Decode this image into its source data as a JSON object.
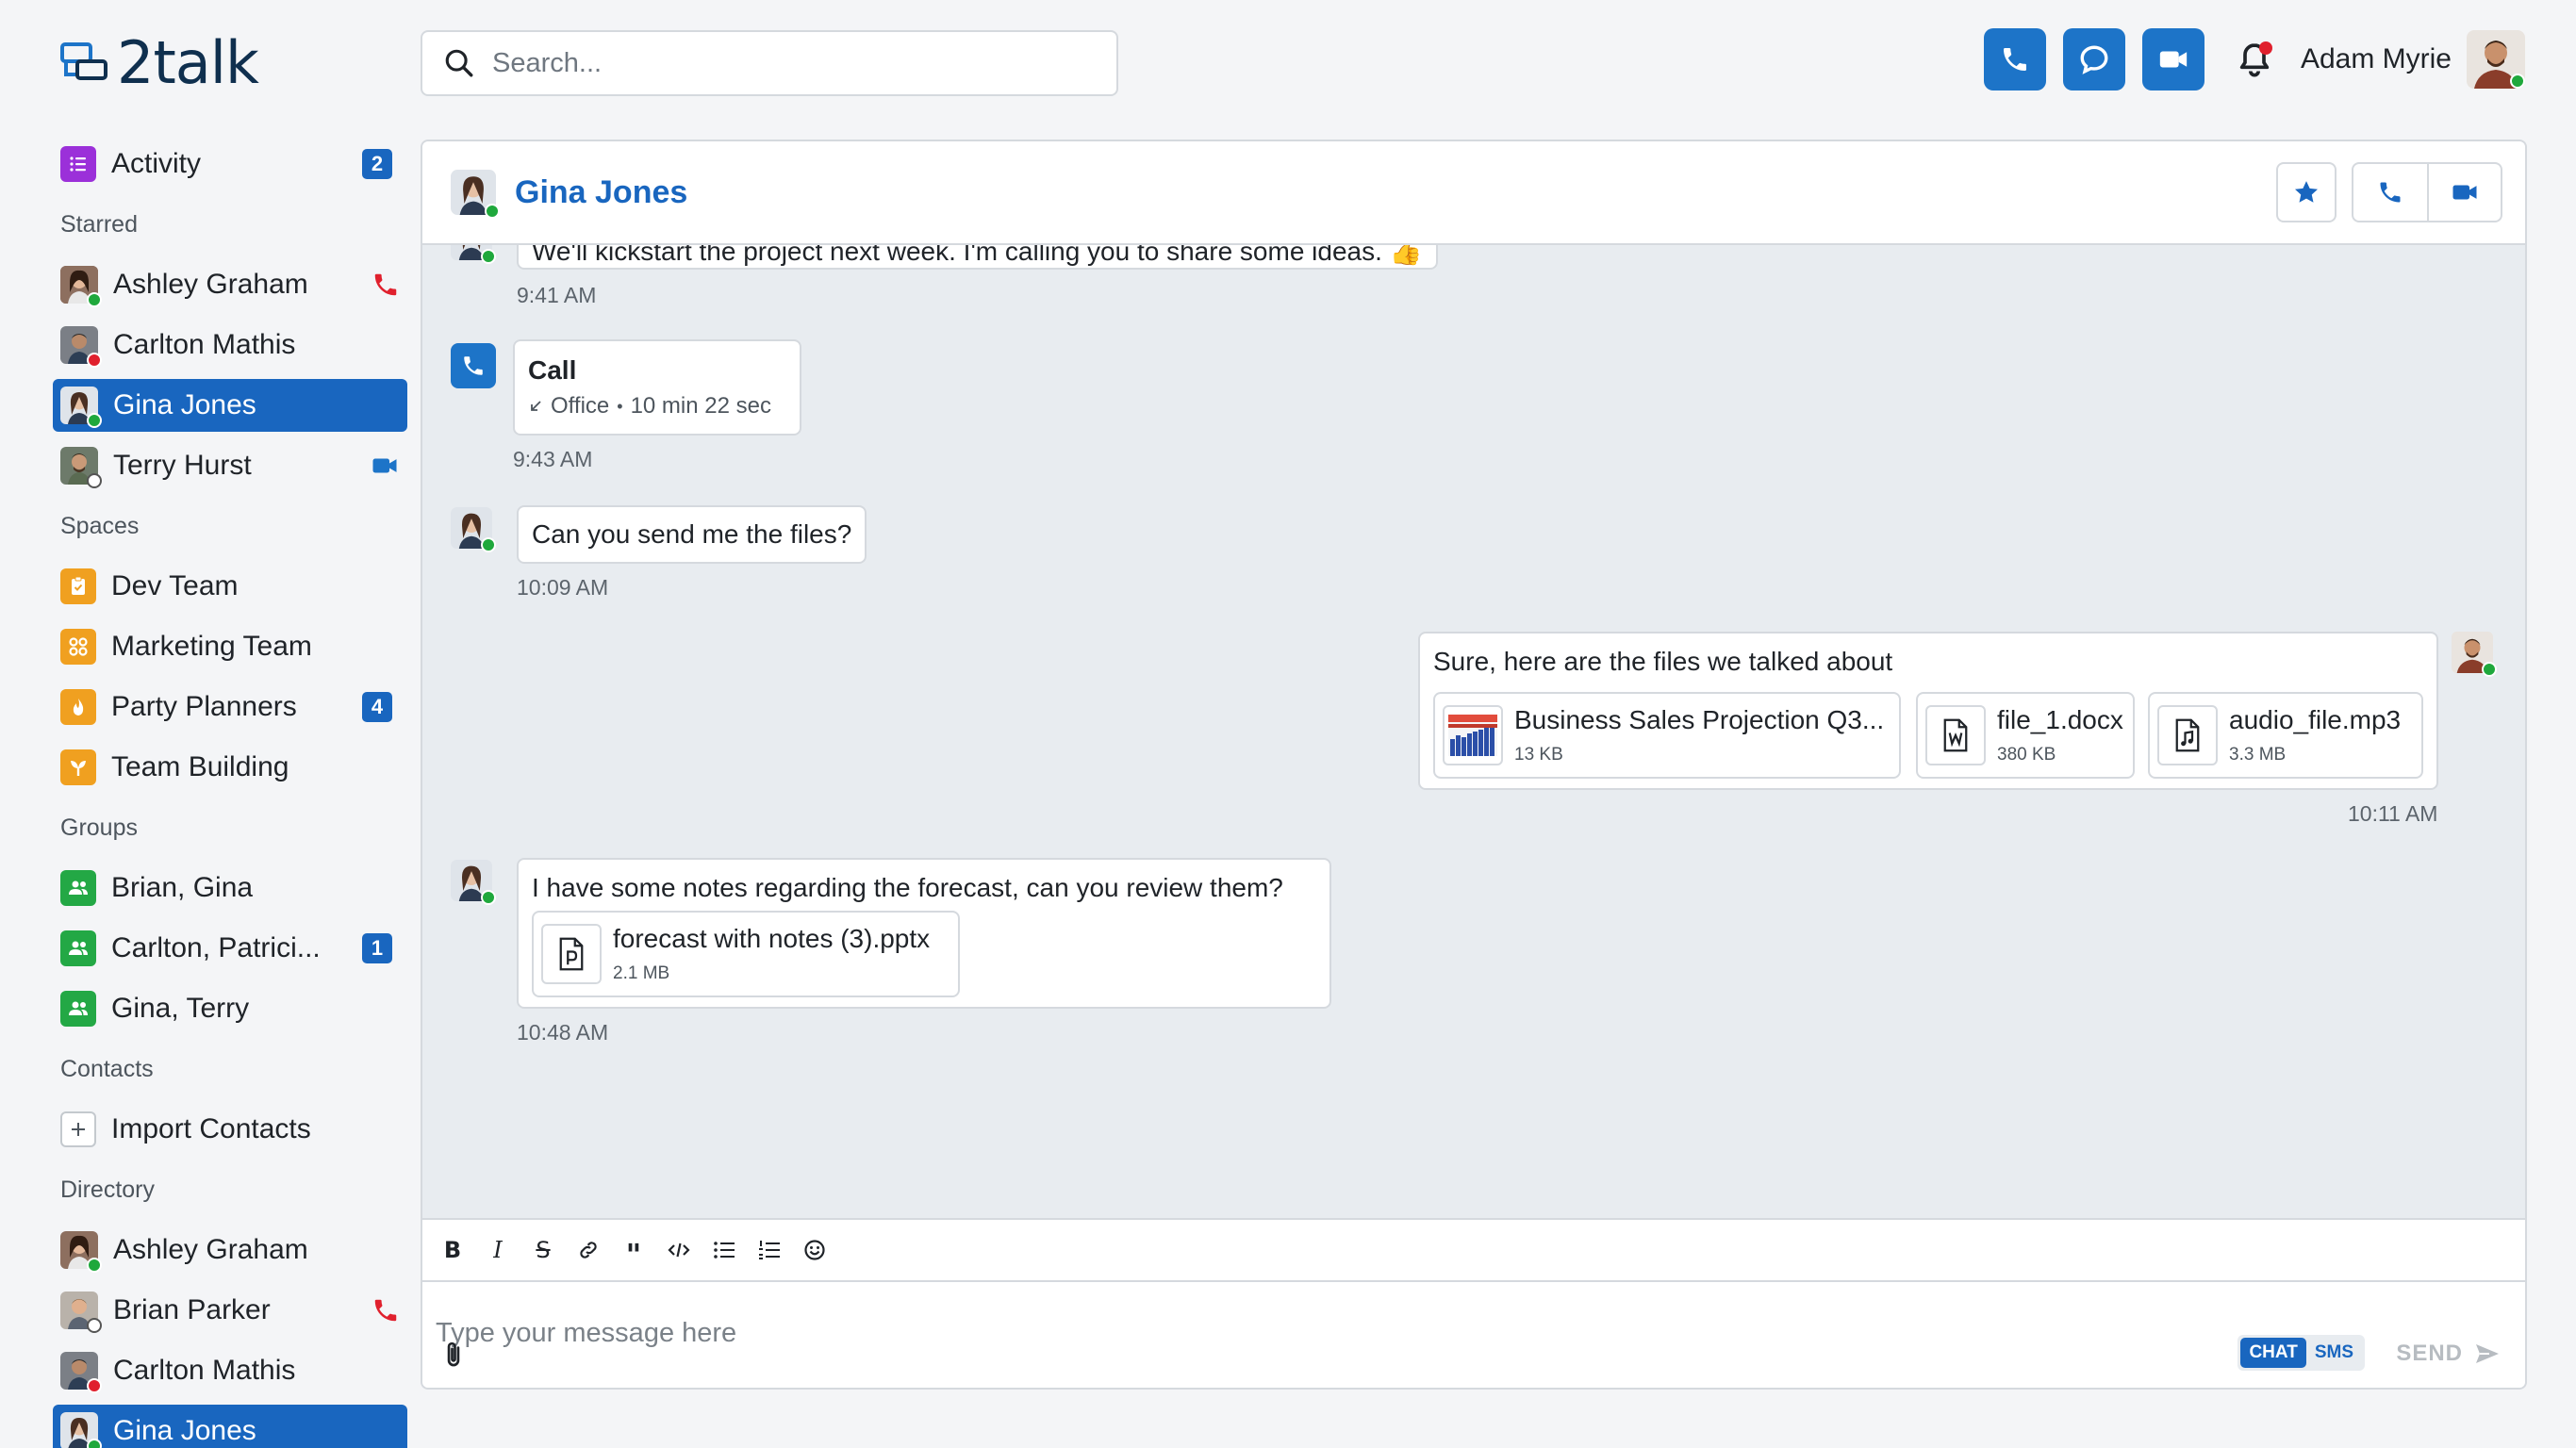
{
  "app": {
    "logo_text": "2talk"
  },
  "search": {
    "placeholder": "Search..."
  },
  "user": {
    "name": "Adam Myrie"
  },
  "sidebar": {
    "activity": {
      "label": "Activity",
      "badge": "2"
    },
    "sections": {
      "starred": "Starred",
      "spaces": "Spaces",
      "groups": "Groups",
      "contacts": "Contacts",
      "directory": "Directory"
    },
    "starred": [
      {
        "label": "Ashley Graham",
        "status": "green",
        "trailing": "phone-icon-red"
      },
      {
        "label": "Carlton Mathis",
        "status": "red"
      },
      {
        "label": "Gina Jones",
        "status": "green",
        "active": true
      },
      {
        "label": "Terry Hurst",
        "status": "gray",
        "trailing": "video-icon-blue"
      }
    ],
    "spaces": [
      {
        "label": "Dev Team",
        "color": "#f0a020"
      },
      {
        "label": "Marketing Team",
        "color": "#f0a020"
      },
      {
        "label": "Party Planners",
        "color": "#f0a020",
        "badge": "4"
      },
      {
        "label": "Team Building",
        "color": "#f0a020"
      }
    ],
    "groups": [
      {
        "label": "Brian, Gina",
        "color": "#23a845"
      },
      {
        "label": "Carlton, Patrici...",
        "color": "#23a845",
        "badge": "1"
      },
      {
        "label": "Gina, Terry",
        "color": "#23a845"
      }
    ],
    "contacts": [
      {
        "label": "Import Contacts"
      }
    ],
    "directory": [
      {
        "label": "Ashley Graham",
        "status": "green"
      },
      {
        "label": "Brian Parker",
        "status": "gray",
        "trailing": "phone-icon-red"
      },
      {
        "label": "Carlton Mathis",
        "status": "red"
      },
      {
        "label": "Gina Jones",
        "status": "green",
        "active": true
      }
    ]
  },
  "chat": {
    "contact_name": "Gina Jones",
    "messages": {
      "m1": {
        "text": "We'll kickstart the project next week. I'm calling you to share some ideas. 👍",
        "time": "9:41 AM"
      },
      "call": {
        "title": "Call",
        "location": "Office",
        "duration": "10 min 22 sec",
        "time": "9:43 AM"
      },
      "m2": {
        "text": "Can you send me the files?",
        "time": "10:09 AM"
      },
      "m3": {
        "text": "Sure, here are the files we talked about",
        "time": "10:11 AM",
        "attachments": [
          {
            "name": "Business Sales Projection Q3...",
            "size": "13 KB"
          },
          {
            "name": "file_1.docx",
            "size": "380 KB"
          },
          {
            "name": "audio_file.mp3",
            "size": "3.3 MB"
          }
        ]
      },
      "m4": {
        "text": "I have some notes regarding the forecast, can you review them?",
        "time": "10:48 AM",
        "attachment": {
          "name": "forecast with notes (3).pptx",
          "size": "2.1 MB"
        }
      }
    }
  },
  "composer": {
    "placeholder": "Type your message here",
    "mode_chat": "CHAT",
    "mode_sms": "SMS",
    "send_label": "SEND"
  },
  "colors": {
    "primary": "#1966bf",
    "online": "#1fa83c",
    "busy": "#e0202d",
    "space": "#f0a020",
    "group": "#23a845",
    "activity": "#9b30d9"
  }
}
